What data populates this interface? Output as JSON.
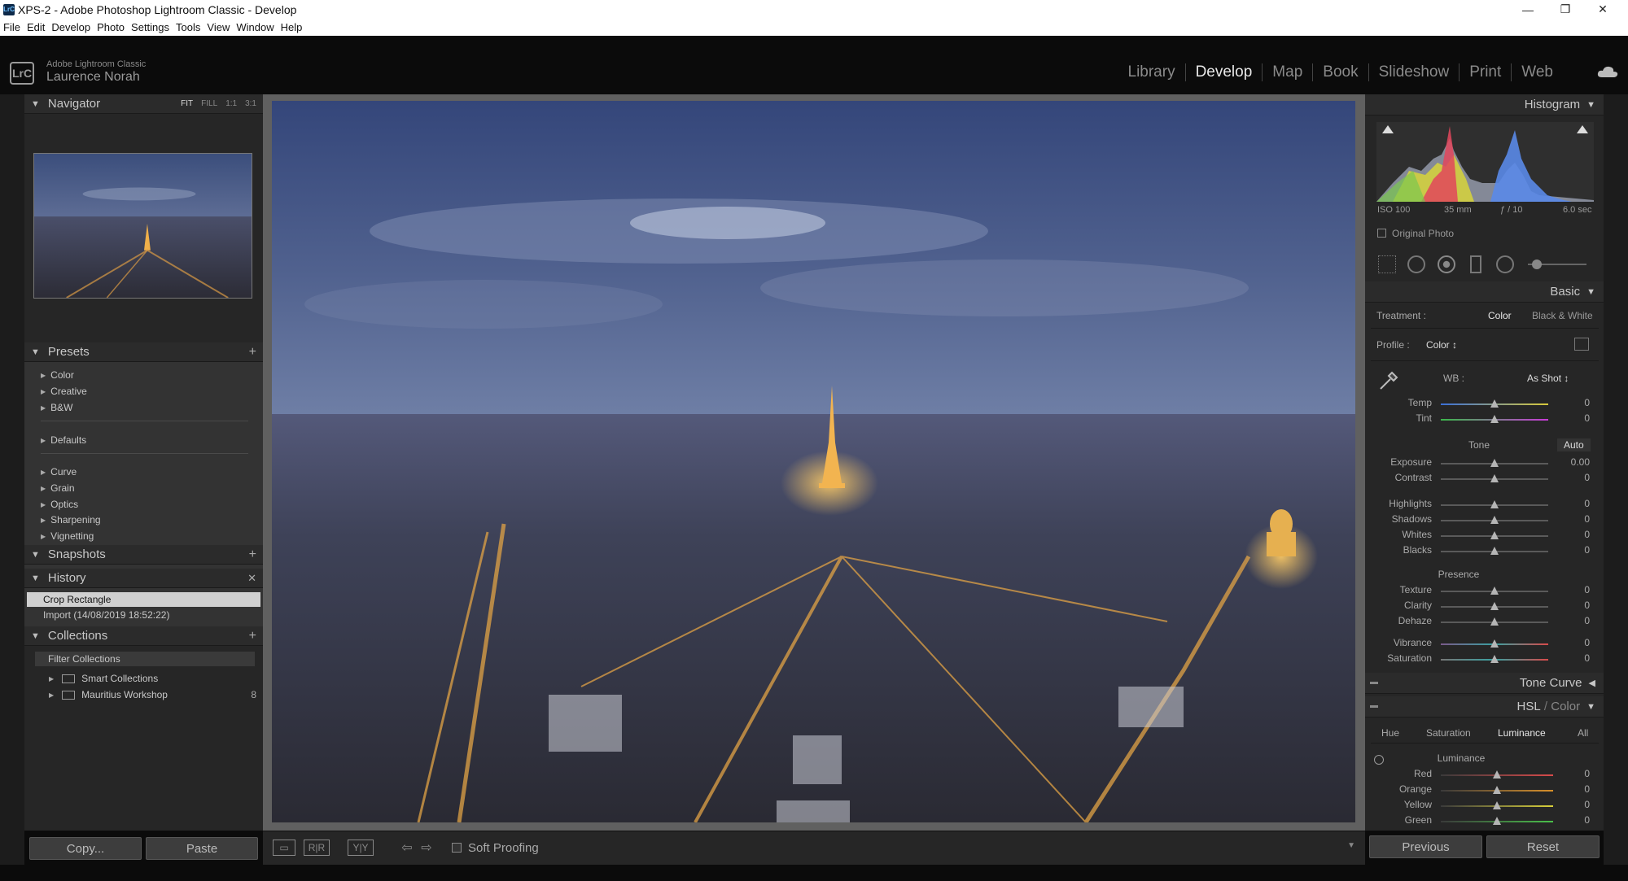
{
  "window": {
    "title": "XPS-2 - Adobe Photoshop Lightroom Classic - Develop",
    "app_icon": "LrC",
    "controls": [
      "minimize-icon",
      "restore-icon",
      "close-icon"
    ]
  },
  "menu": [
    "File",
    "Edit",
    "Develop",
    "Photo",
    "Settings",
    "Tools",
    "View",
    "Window",
    "Help"
  ],
  "identity": {
    "app": "Adobe Lightroom Classic",
    "user": "Laurence Norah",
    "logo": "LrC"
  },
  "modules": [
    {
      "label": "Library"
    },
    {
      "label": "Develop",
      "active": true
    },
    {
      "label": "Map"
    },
    {
      "label": "Book"
    },
    {
      "label": "Slideshow"
    },
    {
      "label": "Print"
    },
    {
      "label": "Web"
    }
  ],
  "navigator": {
    "title": "Navigator",
    "opts": [
      "FIT",
      "FILL",
      "1:1",
      "3:1"
    ]
  },
  "presets": {
    "title": "Presets",
    "groups": [
      "Color",
      "Creative",
      "B&W",
      "Defaults",
      "Curve",
      "Grain",
      "Optics",
      "Sharpening",
      "Vignetting"
    ]
  },
  "snapshots": {
    "title": "Snapshots"
  },
  "history": {
    "title": "History",
    "items": [
      "Crop Rectangle",
      "Import (14/08/2019 18:52:22)"
    ]
  },
  "collections": {
    "title": "Collections",
    "filter": "Filter Collections",
    "items": [
      {
        "label": "Smart Collections",
        "count": ""
      },
      {
        "label": "Mauritius Workshop",
        "count": "8"
      }
    ]
  },
  "left_buttons": {
    "copy": "Copy...",
    "paste": "Paste"
  },
  "toolbar": {
    "soft_proofing": "Soft Proofing"
  },
  "histogram": {
    "title": "Histogram",
    "iso": "ISO 100",
    "focal": "35 mm",
    "aperture": "ƒ / 10",
    "shutter": "6.0 sec",
    "original_photo": "Original Photo"
  },
  "basic": {
    "title": "Basic",
    "treatment_label": "Treatment :",
    "treatment_color": "Color",
    "treatment_bw": "Black & White",
    "profile_label": "Profile :",
    "profile_value": "Color ↕",
    "wb_label": "WB :",
    "wb_value": "As Shot ↕",
    "tone_label": "Tone",
    "auto_label": "Auto",
    "presence_label": "Presence",
    "sliders": [
      {
        "label": "Temp",
        "value": "0",
        "pos": 0.5
      },
      {
        "label": "Tint",
        "value": "0",
        "pos": 0.5
      },
      {
        "label": "Exposure",
        "value": "0.00",
        "pos": 0.5
      },
      {
        "label": "Contrast",
        "value": "0",
        "pos": 0.5
      },
      {
        "label": "Highlights",
        "value": "0",
        "pos": 0.5
      },
      {
        "label": "Shadows",
        "value": "0",
        "pos": 0.5
      },
      {
        "label": "Whites",
        "value": "0",
        "pos": 0.5
      },
      {
        "label": "Blacks",
        "value": "0",
        "pos": 0.5
      },
      {
        "label": "Texture",
        "value": "0",
        "pos": 0.5
      },
      {
        "label": "Clarity",
        "value": "0",
        "pos": 0.5
      },
      {
        "label": "Dehaze",
        "value": "0",
        "pos": 0.5
      },
      {
        "label": "Vibrance",
        "value": "0",
        "pos": 0.5
      },
      {
        "label": "Saturation",
        "value": "0",
        "pos": 0.5
      }
    ]
  },
  "tone_curve": {
    "title": "Tone Curve"
  },
  "hsl": {
    "title_hsl": "HSL",
    "title_sep": " / ",
    "title_color": "Color",
    "tabs": [
      "Hue",
      "Saturation",
      "Luminance",
      "All"
    ],
    "active_tab": "Luminance",
    "section": "Luminance",
    "sliders": [
      {
        "label": "Red",
        "value": "0",
        "pos": 0.5
      },
      {
        "label": "Orange",
        "value": "0",
        "pos": 0.5
      },
      {
        "label": "Yellow",
        "value": "0",
        "pos": 0.5
      },
      {
        "label": "Green",
        "value": "0",
        "pos": 0.5
      }
    ]
  },
  "right_buttons": {
    "previous": "Previous",
    "reset": "Reset"
  },
  "colors": {
    "accent": "#e8e8e8",
    "panel": "#262626",
    "background": "#0b0b0b"
  }
}
